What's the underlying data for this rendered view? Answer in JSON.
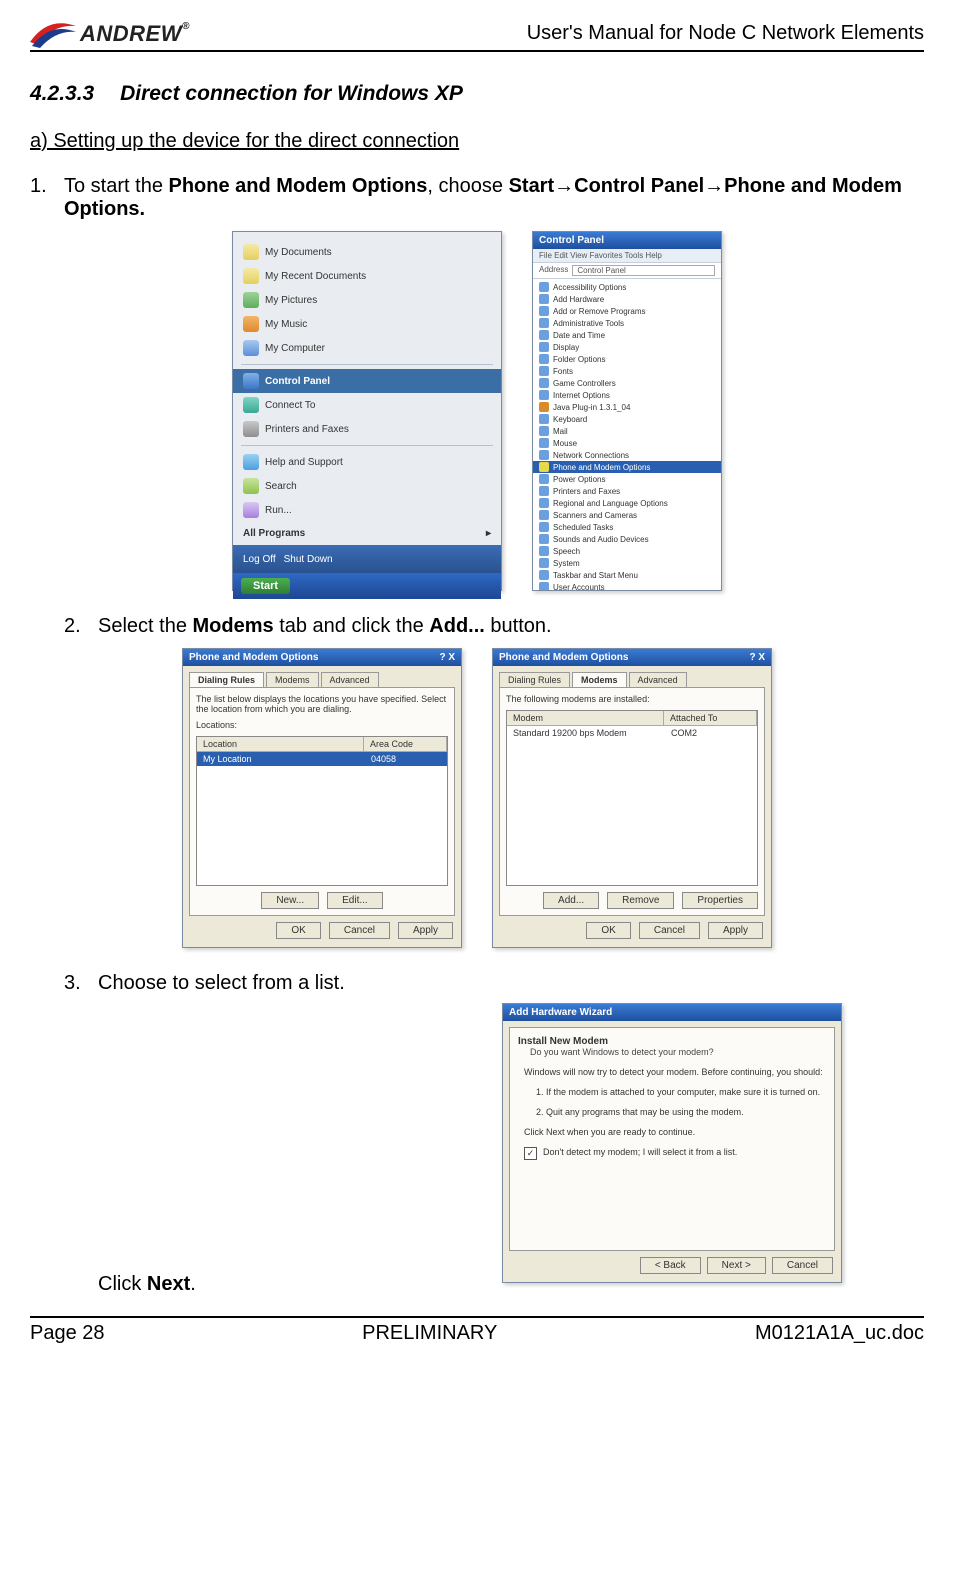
{
  "header": {
    "logo_text": "ANDREW",
    "doc_title": "User's Manual for Node C Network Elements"
  },
  "section": {
    "number": "4.2.3.3",
    "title": "Direct connection for Windows XP"
  },
  "sub_a": "a) Setting up the device for the direct connection",
  "step1": {
    "num": "1.",
    "pre": "To start the ",
    "b1": "Phone and Modem Options",
    "mid": ", choose ",
    "b2": "Start",
    "arrow1": "→",
    "b3": "Control Panel",
    "arrow2": "→",
    "b4": "Phone and Modem Options."
  },
  "startmenu": {
    "items": [
      {
        "label": "My Documents",
        "cls": "ico-doc"
      },
      {
        "label": "My Recent Documents",
        "cls": "ico-doc"
      },
      {
        "label": "My Pictures",
        "cls": "ico-pic"
      },
      {
        "label": "My Music",
        "cls": "ico-mus"
      },
      {
        "label": "My Computer",
        "cls": "ico-comp"
      }
    ],
    "hl": {
      "label": "Control Panel",
      "cls": "ico-cp"
    },
    "items2": [
      {
        "label": "Connect To",
        "cls": "ico-net"
      },
      {
        "label": "Printers and Faxes",
        "cls": "ico-prn"
      }
    ],
    "items3": [
      {
        "label": "Help and Support",
        "cls": "ico-help"
      },
      {
        "label": "Search",
        "cls": "ico-search"
      },
      {
        "label": "Run...",
        "cls": "ico-run"
      }
    ],
    "allprog": "All Programs",
    "logoff": "Log Off",
    "shutdown": "Shut Down",
    "start": "Start"
  },
  "cpanel": {
    "title": "Control Panel",
    "menu": "File  Edit  View  Favorites  Tools  Help",
    "addr_label": "Address",
    "addr_value": "Control Panel",
    "rows": [
      "Accessibility Options",
      "Add Hardware",
      "Add or Remove Programs",
      "Administrative Tools",
      "Date and Time",
      "Display",
      "Folder Options",
      "Fonts",
      "Game Controllers",
      "Internet Options",
      "Java Plug-in 1.3.1_04",
      "Keyboard",
      "Mail",
      "Mouse",
      "Network Connections"
    ],
    "hl": "Phone and Modem Options",
    "rows2": [
      "Power Options",
      "Printers and Faxes",
      "Regional and Language Options",
      "Scanners and Cameras",
      "Scheduled Tasks",
      "Sounds and Audio Devices",
      "Speech",
      "System",
      "Taskbar and Start Menu",
      "User Accounts"
    ]
  },
  "step2": {
    "num": "2.",
    "pre": "Select the ",
    "b1": "Modems",
    "mid": " tab and click the ",
    "b2": "Add...",
    "post": " button."
  },
  "dlg1": {
    "title": "Phone and Modem Options",
    "close": "? X",
    "tabs": [
      "Dialing Rules",
      "Modems",
      "Advanced"
    ],
    "active": 0,
    "help": "The list below displays the locations you have specified. Select the location from which you are dialing.",
    "label": "Locations:",
    "head1": "Location",
    "head2": "Area Code",
    "row_loc": "My Location",
    "row_code": "04058",
    "btns": [
      "New...",
      "Edit..."
    ],
    "foot": [
      "OK",
      "Cancel",
      "Apply"
    ]
  },
  "dlg2": {
    "title": "Phone and Modem Options",
    "close": "? X",
    "tabs": [
      "Dialing Rules",
      "Modems",
      "Advanced"
    ],
    "active": 1,
    "help": "The following modems are installed:",
    "head1": "Modem",
    "head2": "Attached To",
    "row_modem": "Standard 19200 bps Modem",
    "row_port": "COM2",
    "btns": [
      "Add...",
      "Remove",
      "Properties"
    ],
    "foot": [
      "OK",
      "Cancel",
      "Apply"
    ]
  },
  "step3": {
    "num": "3.",
    "text": "Choose to select from a list."
  },
  "wizard": {
    "title": "Add Hardware Wizard",
    "head": "Install New Modem",
    "sub": "Do you want Windows to detect your modem?",
    "text_intro": "Windows will now try to detect your modem. Before continuing, you should:",
    "text_1": "1. If the modem is attached to your computer, make sure it is turned on.",
    "text_2": "2. Quit any programs that may be using the modem.",
    "text_3": "Click Next when you are ready to continue.",
    "chk_label": "Don't detect my modem; I will select it from a list.",
    "foot": [
      "< Back",
      "Next >",
      "Cancel"
    ]
  },
  "click_next_pre": "Click ",
  "click_next_b": "Next",
  "click_next_post": ".",
  "footer": {
    "left": "Page 28",
    "center": "PRELIMINARY",
    "right": "M0121A1A_uc.doc"
  }
}
